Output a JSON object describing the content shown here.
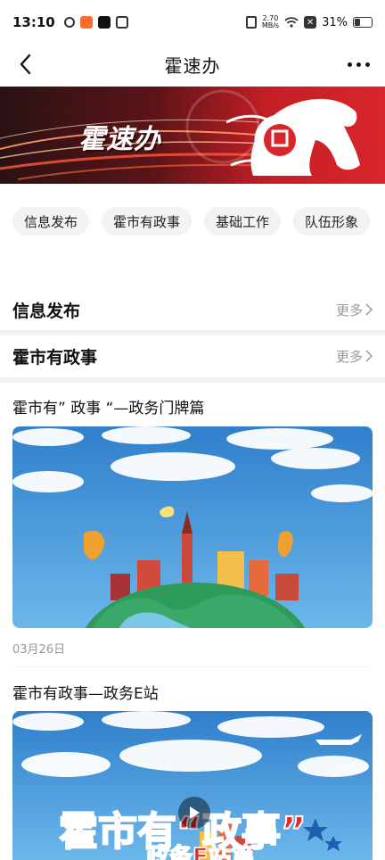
{
  "status_bar": {
    "time": "13:10",
    "net_speed_value": "2.70",
    "net_speed_unit": "MB/s",
    "battery": "31%"
  },
  "header": {
    "title": "霍速办"
  },
  "banner": {
    "text": "霍速办"
  },
  "tags": [
    {
      "label": "信息发布"
    },
    {
      "label": "霍市有政事"
    },
    {
      "label": "基础工作"
    },
    {
      "label": "队伍形象"
    }
  ],
  "sections": [
    {
      "title": "信息发布",
      "more": "更多"
    },
    {
      "title": "霍市有政事",
      "more": "更多"
    }
  ],
  "articles": [
    {
      "title": "霍市有” 政事 “—政务门牌篇",
      "date": "03月26日"
    },
    {
      "title": "霍市有政事—政务E站",
      "thumb_text_1": "霍市有“政事”",
      "thumb_text_2": "政务E站篇"
    }
  ],
  "colors": {
    "banner_red": "#d8262b",
    "sky_blue": "#3d8fd6",
    "muted_text": "#999999"
  }
}
